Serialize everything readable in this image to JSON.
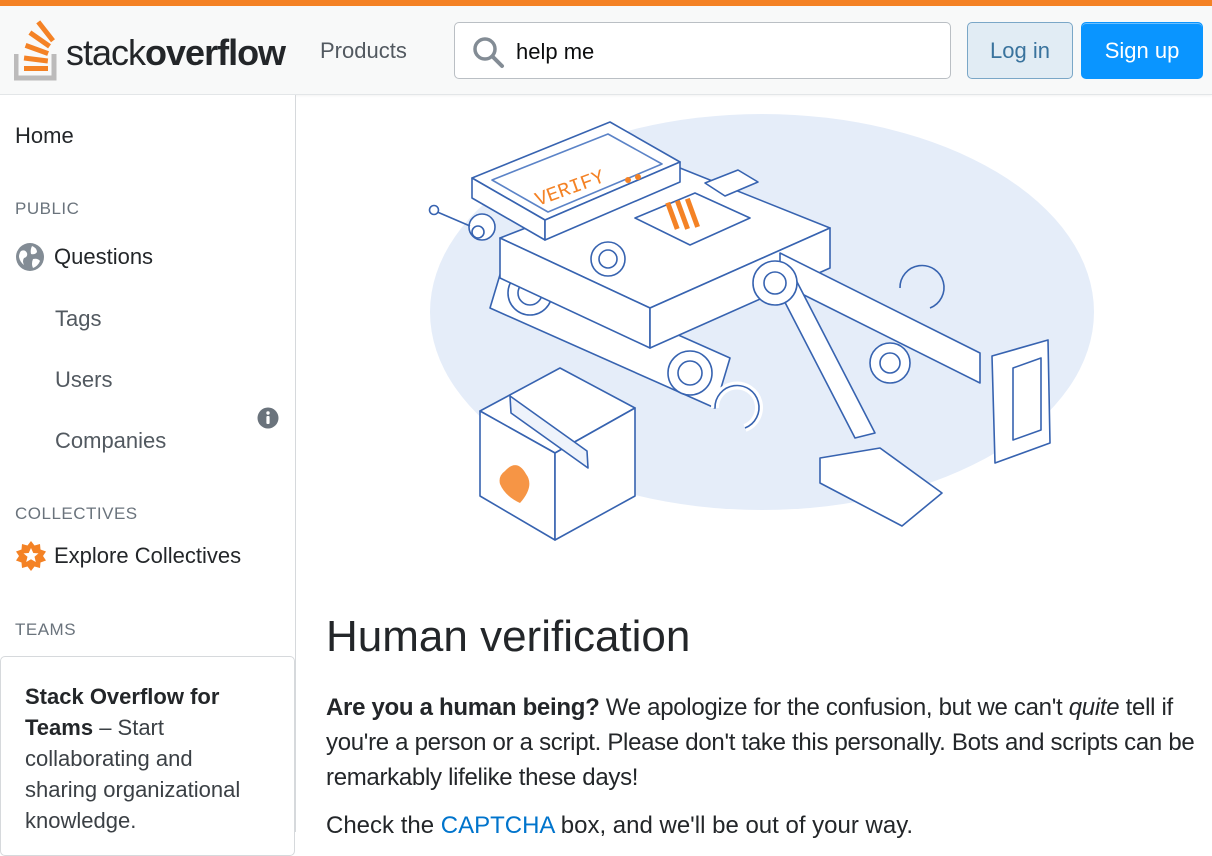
{
  "brand": {
    "logo_light": "stack",
    "logo_bold": "overflow",
    "accent_color": "#f48225",
    "primary_color": "#0a95ff"
  },
  "header": {
    "products_label": "Products",
    "search_value": "help me",
    "login_label": "Log in",
    "signup_label": "Sign up",
    "search_icon": "search-icon"
  },
  "sidebar": {
    "home_label": "Home",
    "public_label": "PUBLIC",
    "questions_label": "Questions",
    "tags_label": "Tags",
    "users_label": "Users",
    "companies_label": "Companies",
    "collectives_label": "COLLECTIVES",
    "explore_label": "Explore Collectives",
    "teams_label": "TEAMS",
    "teams_card_bold": "Stack Overflow for Teams",
    "teams_card_text": " – Start collaborating and sharing organizational knowledge."
  },
  "main": {
    "illustration_text": "VERIFY",
    "title": "Human verification",
    "intro_bold": "Are you a human being?",
    "intro_text_1": " We apologize for the confusion, but we can't ",
    "intro_em": "quite",
    "intro_text_2": " tell if you're a person or a script. Please don't take this personally. Bots and scripts can be remarkably lifelike these days!",
    "next_text_1": "Check the ",
    "next_link": "CAPTCHA",
    "next_text_2": " box, and we'll be out of your way."
  }
}
